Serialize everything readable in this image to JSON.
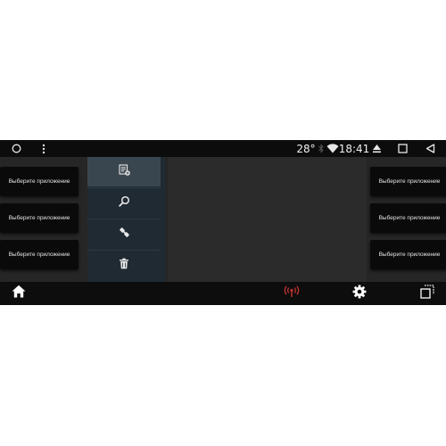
{
  "status_bar": {
    "temperature": "28°",
    "time": "18:41",
    "icons": [
      "circle-icon",
      "more-vert-icon",
      "bluetooth-icon",
      "wifi-icon",
      "eject-icon",
      "square-icon",
      "back-triangle-icon"
    ]
  },
  "left_slots": [
    {
      "label": "Выберите приложение"
    },
    {
      "label": "Выберите приложение"
    },
    {
      "label": "Выберите приложение"
    }
  ],
  "right_slots": [
    {
      "label": "Выберите приложение"
    },
    {
      "label": "Выберите приложение"
    },
    {
      "label": "Выберите приложение"
    }
  ],
  "menu": {
    "items": [
      "add-list-icon",
      "search-icon",
      "tool-icon",
      "trash-icon"
    ]
  },
  "bottom_bar": {
    "icons": [
      "home-icon",
      "broadcast-icon",
      "gear-icon",
      "multi-window-icon"
    ],
    "colors": {
      "broadcast": "#c4332f",
      "default": "#ffffff"
    }
  }
}
